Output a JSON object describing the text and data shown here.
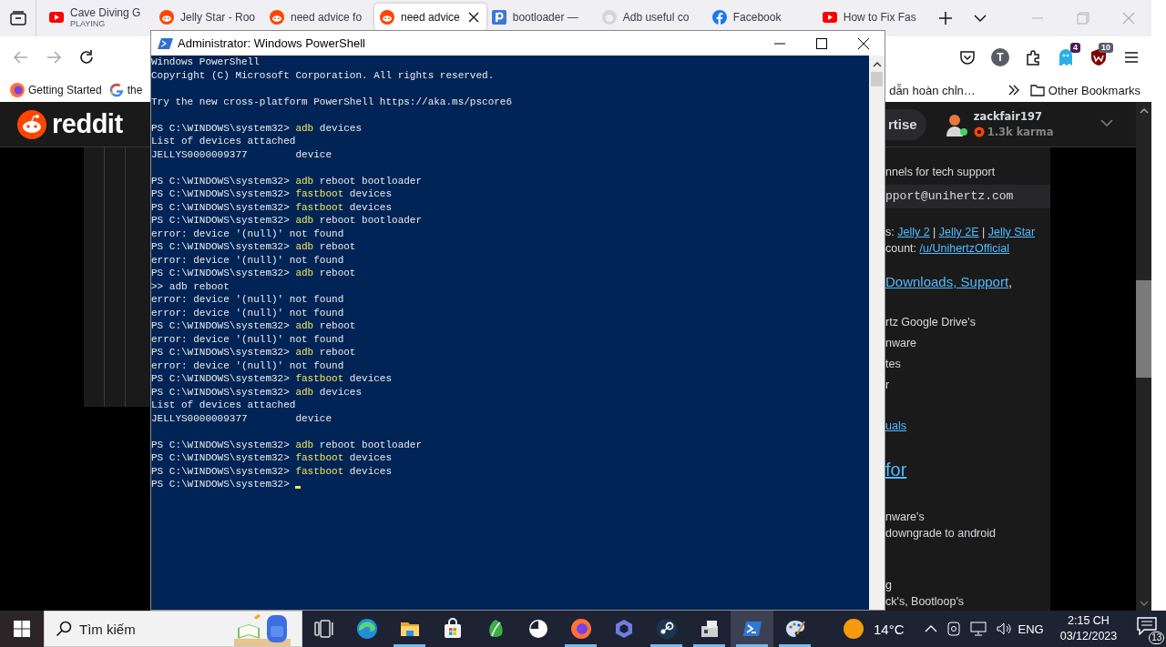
{
  "browser": {
    "tabs": [
      {
        "kind": "youtube",
        "title": "Cave Diving G",
        "subtitle": "PLAYING",
        "selected": false
      },
      {
        "kind": "reddit",
        "title": "Jelly Star - Roo",
        "selected": false
      },
      {
        "kind": "reddit",
        "title": "need advice fo",
        "selected": false
      },
      {
        "kind": "reddit",
        "title": "need advice",
        "selected": true
      },
      {
        "kind": "pcloud",
        "title": "bootloader —",
        "selected": false
      },
      {
        "kind": "github",
        "title": "Adb useful co",
        "selected": false
      },
      {
        "kind": "facebook",
        "title": "Facebook",
        "selected": false
      },
      {
        "kind": "youtube",
        "title": "How to Fix Fas",
        "selected": false
      }
    ],
    "account_initial": "T",
    "extensions": [
      {
        "kind": "ghost",
        "badge": "4"
      },
      {
        "kind": "shield",
        "badge": "10"
      }
    ],
    "bookmarks": [
      {
        "kind": "firefox",
        "label": "Getting Started"
      },
      {
        "kind": "google",
        "label": "the"
      }
    ],
    "bookmark_partial": "dẫn hoàn chỉn…",
    "other_bookmarks": "Other Bookmarks"
  },
  "reddit": {
    "logo_text": "reddit",
    "advertise_button": "rtise",
    "username": "zackfair197",
    "karma": "1.3k karma",
    "sidebar_lines": [
      {
        "kind": "text",
        "parts": [
          {
            "text": "nnels for tech support",
            "link": false
          }
        ]
      },
      {
        "kind": "code",
        "parts": [
          {
            "text": "pport@unihertz.com",
            "link": false
          }
        ]
      },
      {
        "kind": "text",
        "parts": [
          {
            "text": "s: ",
            "link": false
          },
          {
            "text": "Jelly 2",
            "link": true
          },
          {
            "text": " | ",
            "link": false
          },
          {
            "text": "Jelly 2E",
            "link": true
          },
          {
            "text": " | ",
            "link": false
          },
          {
            "text": "Jelly Star",
            "link": true
          }
        ]
      },
      {
        "kind": "text",
        "parts": [
          {
            "text": "count: ",
            "link": false
          },
          {
            "text": "/u/UnihertzOfficial",
            "link": true
          }
        ]
      },
      {
        "kind": "heading",
        "parts": [
          {
            "text": "Downloads, Support",
            "link": true
          },
          {
            "text": ",",
            "link": false
          }
        ]
      },
      {
        "kind": "text",
        "parts": [
          {
            "text": "rtz Google Drive's",
            "link": false
          }
        ]
      },
      {
        "kind": "text",
        "parts": [
          {
            "text": "nware",
            "link": false
          }
        ]
      },
      {
        "kind": "text",
        "parts": [
          {
            "text": "tes",
            "link": false
          }
        ]
      },
      {
        "kind": "text",
        "parts": [
          {
            "text": "r",
            "link": false
          }
        ]
      },
      {
        "kind": "text",
        "parts": [
          {
            "text": "uals",
            "link": true
          }
        ]
      },
      {
        "kind": "large",
        "parts": [
          {
            "text": "for",
            "link": true
          }
        ]
      },
      {
        "kind": "text",
        "parts": [
          {
            "text": "nware's",
            "link": false
          }
        ]
      },
      {
        "kind": "text",
        "parts": [
          {
            "text": "downgrade to android",
            "link": false
          }
        ]
      },
      {
        "kind": "text",
        "parts": [
          {
            "text": "g",
            "link": false
          }
        ]
      },
      {
        "kind": "text",
        "parts": [
          {
            "text": "ck's, Bootloop's",
            "link": false
          }
        ]
      }
    ]
  },
  "powershell": {
    "title": "Administrator: Windows PowerShell",
    "blocks": [
      [
        {
          "kind": "output",
          "text": "Windows PowerShell"
        },
        {
          "kind": "output",
          "text": "Copyright (C) Microsoft Corporation. All rights reserved."
        }
      ],
      [
        {
          "kind": "output",
          "text": "Try the new cross-platform PowerShell https://aka.ms/pscore6"
        }
      ],
      [
        {
          "kind": "command",
          "prompt": "PS C:\\WINDOWS\\system32>",
          "program": "adb",
          "args": "devices"
        },
        {
          "kind": "output",
          "text": "List of devices attached"
        },
        {
          "kind": "output",
          "text": "JELLYS0000009377        device"
        }
      ],
      [
        {
          "kind": "command",
          "prompt": "PS C:\\WINDOWS\\system32>",
          "program": "adb",
          "args": "reboot bootloader"
        },
        {
          "kind": "command",
          "prompt": "PS C:\\WINDOWS\\system32>",
          "program": "fastboot",
          "args": "devices"
        },
        {
          "kind": "command",
          "prompt": "PS C:\\WINDOWS\\system32>",
          "program": "fastboot",
          "args": "devices"
        },
        {
          "kind": "command",
          "prompt": "PS C:\\WINDOWS\\system32>",
          "program": "adb",
          "args": "reboot bootloader"
        },
        {
          "kind": "output",
          "text": "error: device '(null)' not found"
        },
        {
          "kind": "command",
          "prompt": "PS C:\\WINDOWS\\system32>",
          "program": "adb",
          "args": "reboot"
        },
        {
          "kind": "output",
          "text": "error: device '(null)' not found"
        },
        {
          "kind": "command",
          "prompt": "PS C:\\WINDOWS\\system32>",
          "program": "adb",
          "args": "reboot"
        },
        {
          "kind": "output",
          "text": ">> adb reboot"
        },
        {
          "kind": "output",
          "text": "error: device '(null)' not found"
        },
        {
          "kind": "output",
          "text": "error: device '(null)' not found"
        },
        {
          "kind": "command",
          "prompt": "PS C:\\WINDOWS\\system32>",
          "program": "adb",
          "args": "reboot"
        },
        {
          "kind": "output",
          "text": "error: device '(null)' not found"
        },
        {
          "kind": "command",
          "prompt": "PS C:\\WINDOWS\\system32>",
          "program": "adb",
          "args": "reboot"
        },
        {
          "kind": "output",
          "text": "error: device '(null)' not found"
        },
        {
          "kind": "command",
          "prompt": "PS C:\\WINDOWS\\system32>",
          "program": "fastboot",
          "args": "devices"
        },
        {
          "kind": "command",
          "prompt": "PS C:\\WINDOWS\\system32>",
          "program": "adb",
          "args": "devices"
        },
        {
          "kind": "output",
          "text": "List of devices attached"
        },
        {
          "kind": "output",
          "text": "JELLYS0000009377        device"
        }
      ],
      [
        {
          "kind": "command",
          "prompt": "PS C:\\WINDOWS\\system32>",
          "program": "adb",
          "args": "reboot bootloader"
        },
        {
          "kind": "command",
          "prompt": "PS C:\\WINDOWS\\system32>",
          "program": "fastboot",
          "args": "devices"
        },
        {
          "kind": "command",
          "prompt": "PS C:\\WINDOWS\\system32>",
          "program": "fastboot",
          "args": "devices"
        },
        {
          "kind": "input",
          "prompt": "PS C:\\WINDOWS\\system32>",
          "cursor": true
        }
      ]
    ]
  },
  "taskbar": {
    "search": {
      "placeholder": "Tìm kiếm"
    },
    "apps": [
      {
        "kind": "task-view",
        "running": false,
        "selected": false
      },
      {
        "kind": "edge",
        "running": false,
        "selected": false
      },
      {
        "kind": "explorer",
        "running": true,
        "selected": false
      },
      {
        "kind": "store",
        "running": false,
        "selected": false
      },
      {
        "kind": "maps",
        "running": false,
        "selected": false
      },
      {
        "kind": "clock",
        "running": false,
        "selected": false
      },
      {
        "kind": "firefox",
        "running": true,
        "selected": false
      },
      {
        "kind": "copilot",
        "running": false,
        "selected": false
      },
      {
        "kind": "steam",
        "running": true,
        "selected": false
      },
      {
        "kind": "device",
        "running": true,
        "selected": false
      },
      {
        "kind": "powershell",
        "running": true,
        "selected": true
      },
      {
        "kind": "paint",
        "running": true,
        "selected": false
      }
    ],
    "temperature": "14°C",
    "language": "ENG",
    "time": "2:15 CH",
    "date": "03/12/2023",
    "notifications": "13"
  }
}
